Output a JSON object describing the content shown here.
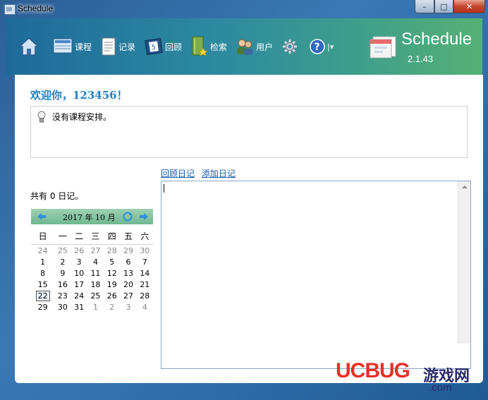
{
  "window": {
    "title": "Schedule",
    "minimize": "–",
    "maximize": "□",
    "close": "✕"
  },
  "toolbar": {
    "items": [
      {
        "icon": "home-icon",
        "label": ""
      },
      {
        "icon": "course-icon",
        "label": "课程"
      },
      {
        "icon": "record-icon",
        "label": "记录"
      },
      {
        "icon": "review-icon",
        "label": "回顾"
      },
      {
        "icon": "search-icon",
        "label": "检索"
      },
      {
        "icon": "users-icon",
        "label": "用户"
      },
      {
        "icon": "gear-icon",
        "label": ""
      },
      {
        "icon": "help-icon",
        "label": "",
        "dropdown": "|▾"
      }
    ],
    "app_name": "Schedule",
    "app_version": "2.1.43"
  },
  "main": {
    "welcome": "欢迎你，123456！",
    "notice": "没有课程安排。",
    "links": {
      "review": "回顾日记",
      "add": "添加日记"
    },
    "count": "共有 0 日记。"
  },
  "calendar": {
    "title": "2017 年 10 月",
    "weekdays": [
      "日",
      "一",
      "二",
      "三",
      "四",
      "五",
      "六"
    ],
    "weeks": [
      [
        "24",
        "25",
        "26",
        "27",
        "28",
        "29",
        "30"
      ],
      [
        "1",
        "2",
        "3",
        "4",
        "5",
        "6",
        "7"
      ],
      [
        "8",
        "9",
        "10",
        "11",
        "12",
        "13",
        "14"
      ],
      [
        "15",
        "16",
        "17",
        "18",
        "19",
        "20",
        "21"
      ],
      [
        "22",
        "23",
        "24",
        "25",
        "26",
        "27",
        "28"
      ],
      [
        "29",
        "30",
        "31",
        "1",
        "2",
        "3",
        "4"
      ]
    ],
    "today": "22"
  },
  "watermark": {
    "brand": "UCBUG",
    "site": "游戏网",
    "domain": ".com"
  },
  "colors": {
    "accent": "#1f7fc4",
    "link": "#1a5ea8",
    "toolbar_start": "#1d6a9a",
    "toolbar_end": "#56b174"
  }
}
